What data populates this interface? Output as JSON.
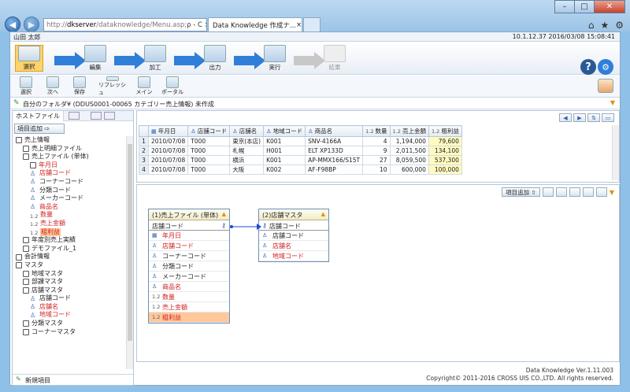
{
  "browser": {
    "url_prefix": "http://",
    "url_host": "dkserver",
    "url_path": "/dataknowledge/Menu.asp;",
    "addr_controls": "ρ - C ×",
    "tab_title": "Data Knowledge 作成ナ...",
    "tab_close": "×",
    "icons": [
      "back-icon",
      "forward-icon",
      "home-icon",
      "star-icon",
      "settings-icon"
    ]
  },
  "user": {
    "name": "山田 太郎",
    "status": "10.1.12.37  2016/03/08 15:08:41"
  },
  "steps": [
    {
      "label": "選択",
      "state": "selected"
    },
    {
      "label": "編集",
      "state": "normal"
    },
    {
      "label": "加工",
      "state": "normal"
    },
    {
      "label": "出力",
      "state": "normal"
    },
    {
      "label": "実行",
      "state": "normal"
    },
    {
      "label": "結果",
      "state": "disabled"
    }
  ],
  "toolbar": {
    "buttons": [
      "選択",
      "次へ",
      "保存",
      "リフレッシュ",
      "メイン",
      "ポータル"
    ]
  },
  "path": {
    "text": "自分のフォルダ¥ (DDUS0001-00065 カテゴリー売上情報)  未作成"
  },
  "left_panel": {
    "tab_label": "ホストファイル",
    "add_item_label": "項目追加 ⇨",
    "new_item_label": "新規項目",
    "tree": [
      {
        "label": "売上情報",
        "indent": 0,
        "icon": "folder",
        "color": "normal"
      },
      {
        "label": "売上明細ファイル",
        "indent": 1,
        "icon": "file",
        "color": "normal"
      },
      {
        "label": "売上ファイル (単体)",
        "indent": 1,
        "icon": "file",
        "color": "normal"
      },
      {
        "label": "年月日",
        "indent": 2,
        "icon": "date",
        "color": "red"
      },
      {
        "label": "店舗コード",
        "indent": 2,
        "icon": "key",
        "color": "red"
      },
      {
        "label": "コーナーコード",
        "indent": 2,
        "icon": "key",
        "color": "normal"
      },
      {
        "label": "分類コード",
        "indent": 2,
        "icon": "key",
        "color": "normal"
      },
      {
        "label": "メーカーコード",
        "indent": 2,
        "icon": "key",
        "color": "normal"
      },
      {
        "label": "商品名",
        "indent": 2,
        "icon": "key",
        "color": "red"
      },
      {
        "label": "数量",
        "indent": 2,
        "icon": "num",
        "color": "red"
      },
      {
        "label": "売上金額",
        "indent": 2,
        "icon": "num",
        "color": "red"
      },
      {
        "label": "粗利益",
        "indent": 2,
        "icon": "num",
        "color": "red",
        "highlight": true
      },
      {
        "label": "年度別売上実績",
        "indent": 1,
        "icon": "file",
        "color": "normal"
      },
      {
        "label": "デモファイル_1",
        "indent": 1,
        "icon": "file",
        "color": "normal"
      },
      {
        "label": "会計情報",
        "indent": 0,
        "icon": "folder",
        "color": "normal"
      },
      {
        "label": "マスタ",
        "indent": 0,
        "icon": "folder",
        "color": "normal"
      },
      {
        "label": "地域マスタ",
        "indent": 1,
        "icon": "file",
        "color": "normal"
      },
      {
        "label": "部課マスタ",
        "indent": 1,
        "icon": "file",
        "color": "normal"
      },
      {
        "label": "店舗マスタ",
        "indent": 1,
        "icon": "file",
        "color": "normal"
      },
      {
        "label": "店舗コード",
        "indent": 2,
        "icon": "key",
        "color": "normal"
      },
      {
        "label": "店舗名",
        "indent": 2,
        "icon": "key",
        "color": "red"
      },
      {
        "label": "地域コード",
        "indent": 2,
        "icon": "key",
        "color": "red"
      },
      {
        "label": "分類マスタ",
        "indent": 1,
        "icon": "file",
        "color": "normal"
      },
      {
        "label": "コーナーマスタ",
        "indent": 1,
        "icon": "file",
        "color": "normal"
      }
    ]
  },
  "grid": {
    "columns": [
      {
        "label": "年月日",
        "icon": "date"
      },
      {
        "label": "店舗コード",
        "icon": "key"
      },
      {
        "label": "店舗名",
        "icon": "key"
      },
      {
        "label": "地域コード",
        "icon": "key"
      },
      {
        "label": "商品名",
        "icon": "key"
      },
      {
        "label": "数量",
        "icon": "num"
      },
      {
        "label": "売上金額",
        "icon": "num"
      },
      {
        "label": "粗利益",
        "icon": "num"
      }
    ],
    "rows": [
      [
        "1",
        "2010/07/08",
        "T000",
        "東京(本店)",
        "K001",
        "SNV-4166A",
        "4",
        "1,194,000",
        "79,600"
      ],
      [
        "2",
        "2010/07/08",
        "T000",
        "札幌",
        "H001",
        "ELT XP133D",
        "9",
        "2,011,500",
        "134,100"
      ],
      [
        "3",
        "2010/07/08",
        "T000",
        "横浜",
        "K001",
        "AP-MMX166/S15T",
        "27",
        "8,059,500",
        "537,300"
      ],
      [
        "4",
        "2010/07/08",
        "T000",
        "大阪",
        "K002",
        "AF-F98BP",
        "10",
        "600,000",
        "100,000"
      ]
    ]
  },
  "diagram": {
    "add_item_label": "項目追加",
    "entities": [
      {
        "title": "(1)売上ファイル (単体)",
        "key": "店舗コード",
        "fields": [
          {
            "label": "年月日",
            "icon": "date",
            "color": "red"
          },
          {
            "label": "店舗コード",
            "icon": "key",
            "color": "red"
          },
          {
            "label": "コーナーコード",
            "icon": "key",
            "color": "normal"
          },
          {
            "label": "分類コード",
            "icon": "key",
            "color": "normal"
          },
          {
            "label": "メーカーコード",
            "icon": "key",
            "color": "normal"
          },
          {
            "label": "商品名",
            "icon": "key",
            "color": "red"
          },
          {
            "label": "数量",
            "icon": "num",
            "color": "red"
          },
          {
            "label": "売上金額",
            "icon": "num",
            "color": "red"
          },
          {
            "label": "粗利益",
            "icon": "num",
            "color": "red",
            "highlight": true
          }
        ]
      },
      {
        "title": "(2)店舗マスタ",
        "key": "店舗コード",
        "fields": [
          {
            "label": "店舗コード",
            "icon": "key",
            "color": "normal"
          },
          {
            "label": "店舗名",
            "icon": "key",
            "color": "red"
          },
          {
            "label": "地域コード",
            "icon": "key",
            "color": "red"
          }
        ]
      }
    ]
  },
  "footer": {
    "version": "Data Knowledge Ver.1.11.003",
    "copyright": "Copyright© 2011-2016 CROSS UIS CO.,LTD. All rights reserved."
  },
  "colors": {
    "accent": "#2f7ed8",
    "selected_step": "#ffd26a",
    "red_field": "#d02020",
    "highlight": "#ffc89a",
    "money_cell": "#fffbc0"
  }
}
